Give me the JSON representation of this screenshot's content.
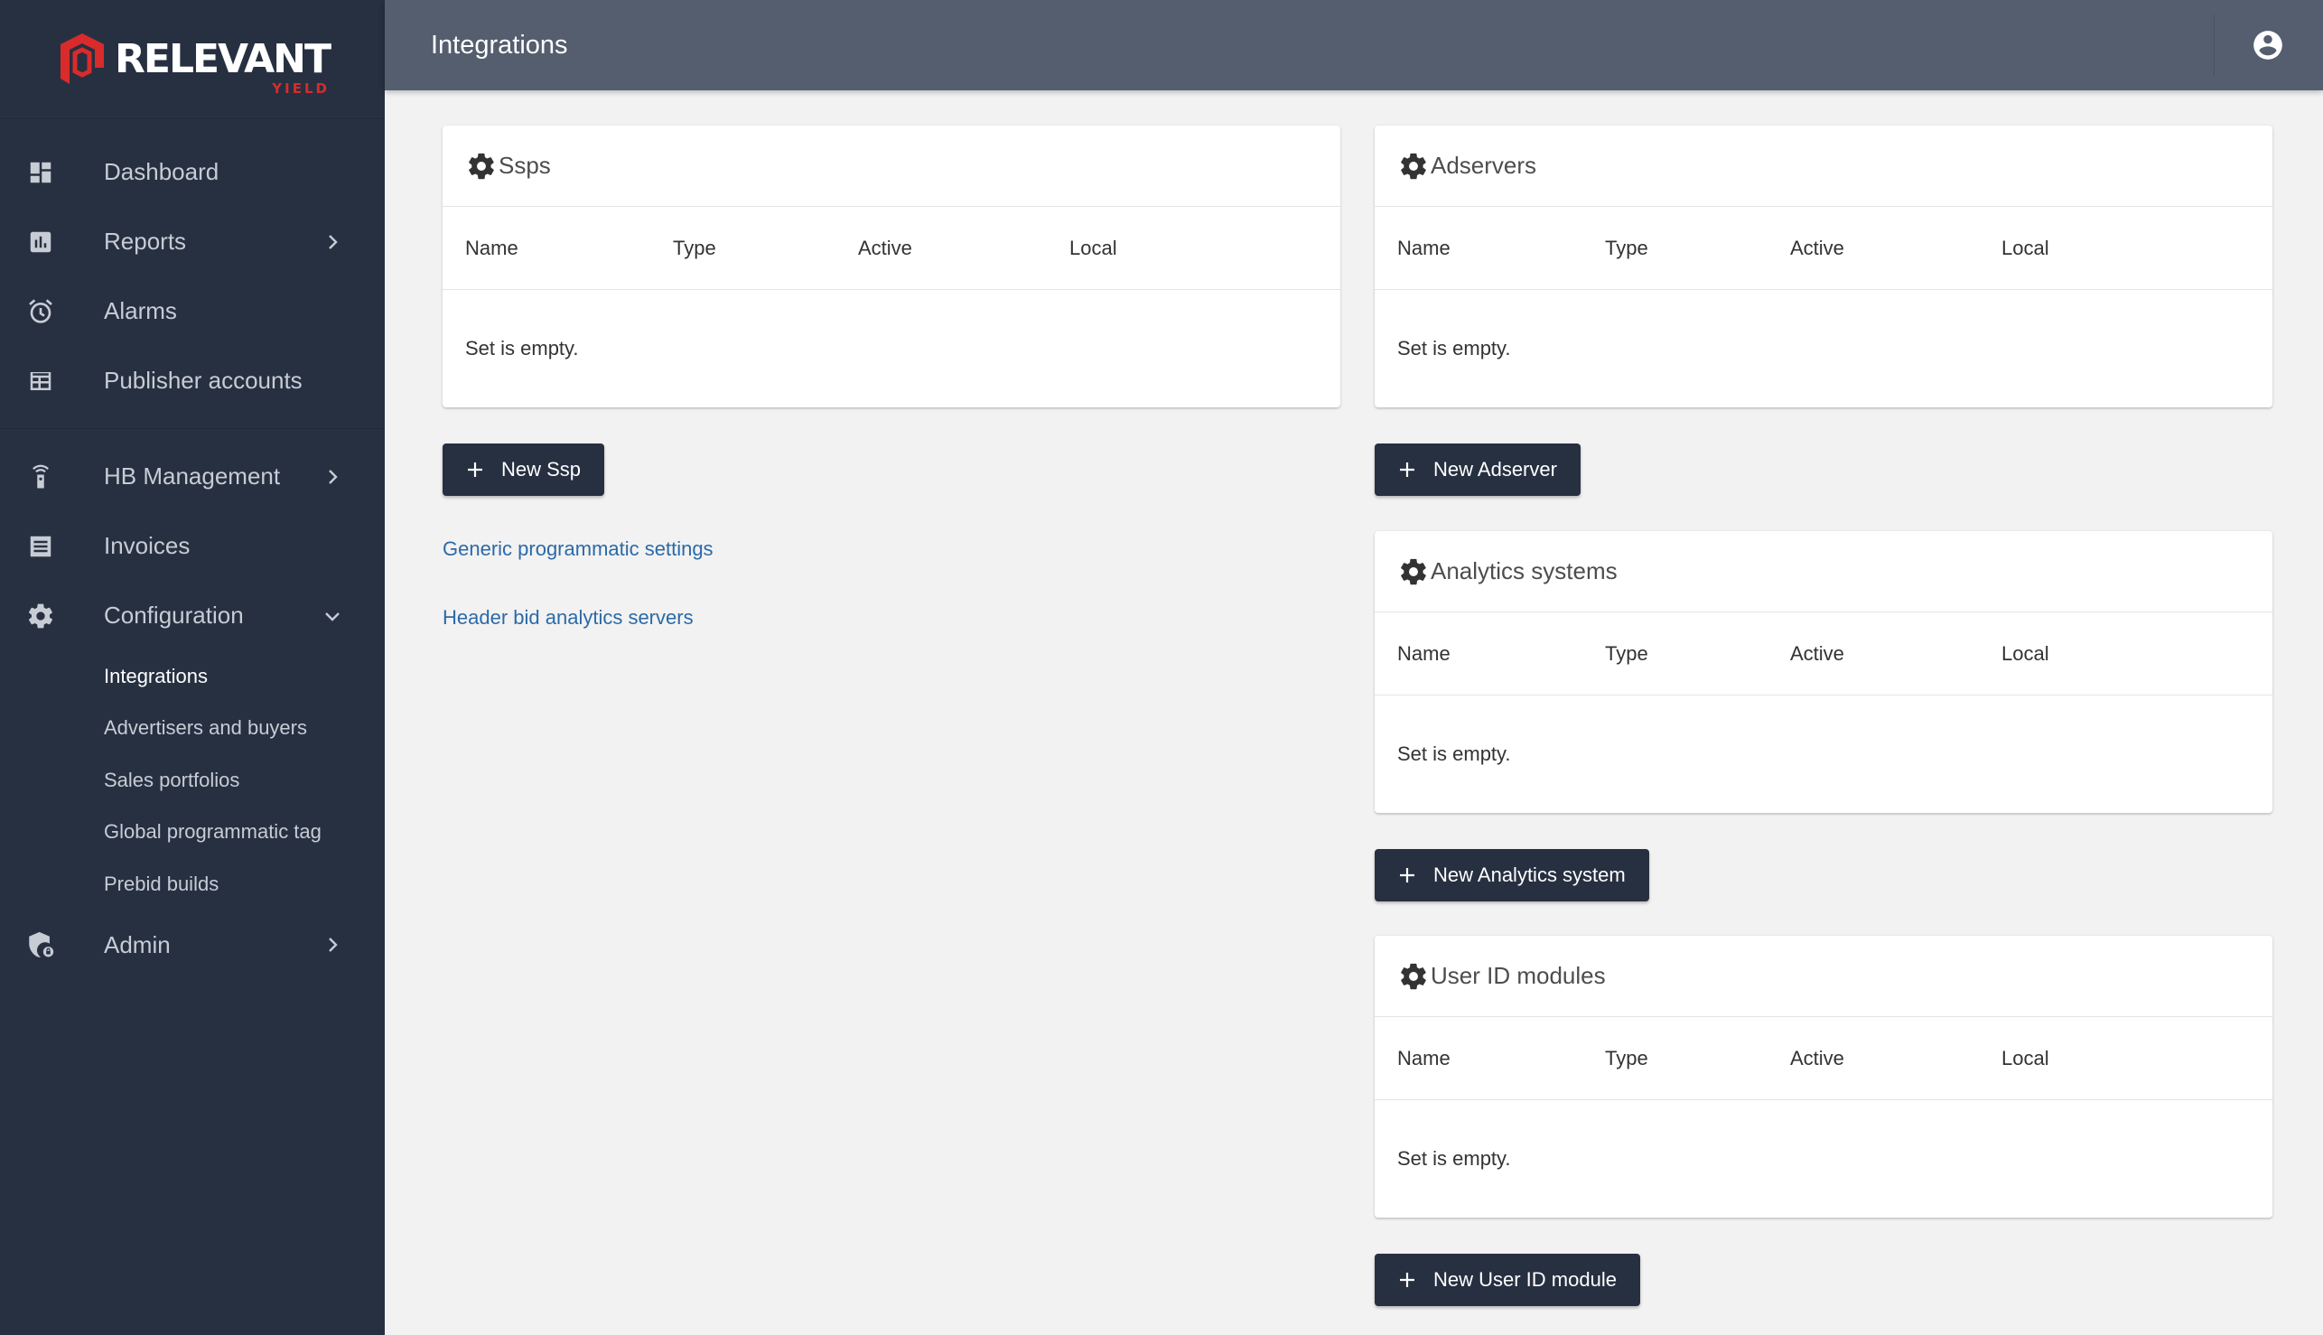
{
  "brand": {
    "name": "RELEVANT",
    "sub": "YIELD",
    "accent": "#d92b2b"
  },
  "topbar": {
    "title": "Integrations"
  },
  "sidebar": {
    "items": [
      {
        "label": "Dashboard"
      },
      {
        "label": "Reports"
      },
      {
        "label": "Alarms"
      },
      {
        "label": "Publisher accounts"
      },
      {
        "label": "HB Management"
      },
      {
        "label": "Invoices"
      },
      {
        "label": "Configuration"
      },
      {
        "label": "Admin"
      }
    ],
    "config_sub": [
      {
        "label": "Integrations"
      },
      {
        "label": "Advertisers and buyers"
      },
      {
        "label": "Sales portfolios"
      },
      {
        "label": "Global programmatic tag"
      },
      {
        "label": "Prebid builds"
      }
    ]
  },
  "columns": [
    "Name",
    "Type",
    "Active",
    "Local"
  ],
  "empty_text": "Set is empty.",
  "cards": {
    "ssps": {
      "title": "Ssps",
      "button": "New Ssp"
    },
    "adservers": {
      "title": "Adservers",
      "button": "New Adserver"
    },
    "analytics": {
      "title": "Analytics systems",
      "button": "New Analytics system"
    },
    "userid": {
      "title": "User ID modules",
      "button": "New User ID module"
    }
  },
  "links": {
    "generic": "Generic programmatic settings",
    "hb_analytics": "Header bid analytics servers"
  },
  "colors": {
    "sidebar": "#273041",
    "topbar": "#555e6e",
    "link": "#2b6aa8",
    "button": "#273041"
  }
}
